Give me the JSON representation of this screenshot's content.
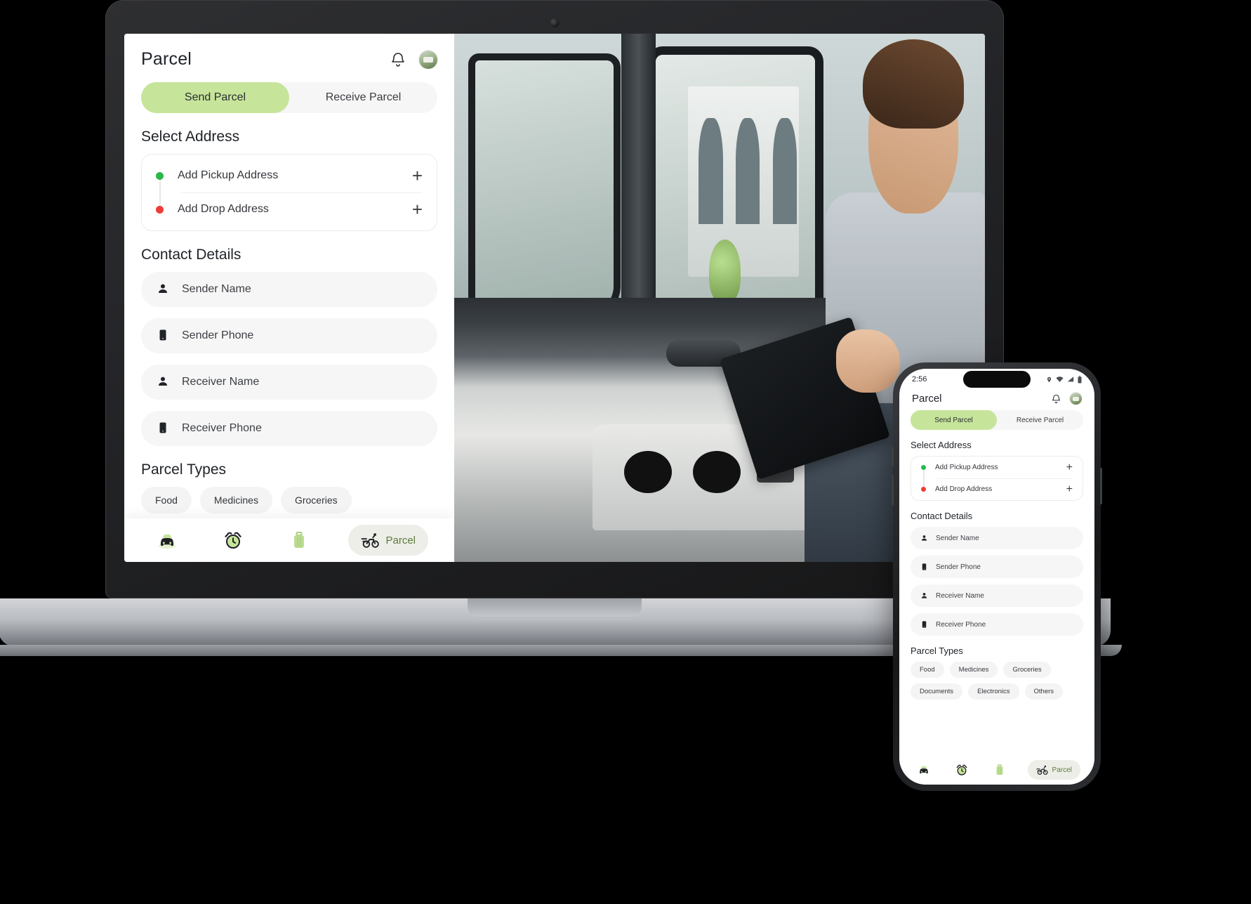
{
  "app": {
    "title": "Parcel",
    "header_icons": [
      "bell-icon",
      "avatar"
    ],
    "tabs": [
      {
        "label": "Send Parcel",
        "active": true
      },
      {
        "label": "Receive Parcel",
        "active": false
      }
    ],
    "sections": {
      "select_address": {
        "title": "Select Address",
        "rows": [
          {
            "label": "Add Pickup Address",
            "dot_color": "#2ab84a",
            "action": "+"
          },
          {
            "label": "Add Drop Address",
            "dot_color": "#ef3b36",
            "action": "+"
          }
        ]
      },
      "contact_details": {
        "title": "Contact Details",
        "fields": [
          {
            "label": "Sender Name",
            "icon": "person-icon"
          },
          {
            "label": "Sender Phone",
            "icon": "phone-icon"
          },
          {
            "label": "Receiver Name",
            "icon": "person-icon"
          },
          {
            "label": "Receiver Phone",
            "icon": "phone-icon"
          }
        ]
      },
      "parcel_types": {
        "title": "Parcel Types",
        "chips": [
          "Food",
          "Medicines",
          "Groceries",
          "Documents",
          "Electronics",
          "Others"
        ]
      }
    },
    "navbar": [
      {
        "label": "",
        "icon": "car-icon",
        "active": false
      },
      {
        "label": "",
        "icon": "alarm-clock-icon",
        "active": false
      },
      {
        "label": "",
        "icon": "suitcase-icon",
        "active": false
      },
      {
        "label": "Parcel",
        "icon": "bike-icon",
        "active": true
      }
    ]
  },
  "phone": {
    "status_bar": {
      "time": "2:56",
      "icons": [
        "location-pin-icon",
        "wifi-icon",
        "signal-icon",
        "battery-icon"
      ]
    }
  },
  "colors": {
    "accent_green": "#c6e49a",
    "nav_active_bg": "#eceee7",
    "nav_label": "#5d7a3e",
    "field_bg": "#f6f6f6",
    "chip_bg": "#f4f4f4",
    "pickup_dot": "#2ab84a",
    "drop_dot": "#ef3b36",
    "text_primary": "#20232a"
  }
}
